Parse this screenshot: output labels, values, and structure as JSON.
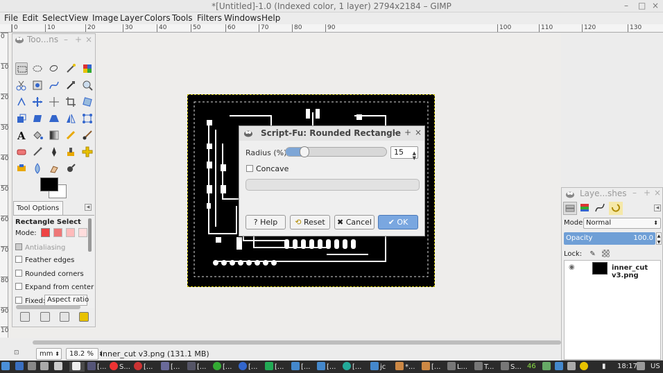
{
  "window": {
    "title": "*[Untitled]-1.0 (Indexed color, 1 layer) 2794x2184 – GIMP",
    "controls": [
      "–",
      "□",
      "×"
    ]
  },
  "menubar": [
    "File",
    "Edit",
    "Select",
    "View",
    "Image",
    "Layer",
    "Colors",
    "Tools",
    "Filters",
    "Windows",
    "Help"
  ],
  "hruler": [
    "0",
    "10",
    "20",
    "30",
    "40",
    "50",
    "60",
    "70",
    "80",
    "90",
    "100",
    "110",
    "120",
    "130"
  ],
  "vruler": [
    "0",
    "10",
    "20",
    "30",
    "40",
    "50",
    "60",
    "70",
    "80",
    "90",
    "100"
  ],
  "toolbox": {
    "title": "Too...ns",
    "options_tab": "Tool Options",
    "tool_name": "Rectangle Select",
    "mode_label": "Mode:",
    "antialiasing": "Antialiasing",
    "feather_edges": "Feather edges",
    "rounded_corners": "Rounded corners",
    "expand_from_center": "Expand from center",
    "fixed_label": "Fixed:",
    "fixed_value": "Aspect ratio"
  },
  "dialog": {
    "title": "Script-Fu: Rounded Rectangle",
    "radius_label": "Radius (%):",
    "radius_value": "15",
    "radius_fraction": 0.15,
    "concave_label": "Concave",
    "buttons": {
      "help": "Help",
      "reset": "Reset",
      "cancel": "Cancel",
      "ok": "OK"
    }
  },
  "layers": {
    "title": "Laye...shes",
    "mode_label": "Mode:",
    "mode_value": "Normal",
    "opacity_label": "Opacity",
    "opacity_value": "100.0",
    "lock_label": "Lock:",
    "layer_name": "inner_cut v3.png"
  },
  "statusbar": {
    "unit": "mm",
    "zoom": "18.2 %",
    "status": "inner_cut v3.png (131.1 MB)"
  },
  "taskbar": {
    "items": [
      "[...",
      "S...",
      "[...",
      "[...",
      "[...",
      "[...",
      "[...",
      "[...",
      "[...",
      "[...",
      "jc",
      "*...",
      "[...",
      "L...",
      "T...",
      "S..."
    ],
    "battery": "46",
    "time": "18:17",
    "keyboard": "US"
  },
  "colors": {
    "accent": "#7aa7e0",
    "taskbar": "#2b2b2b",
    "canvas_bg": "#eeedeb"
  }
}
